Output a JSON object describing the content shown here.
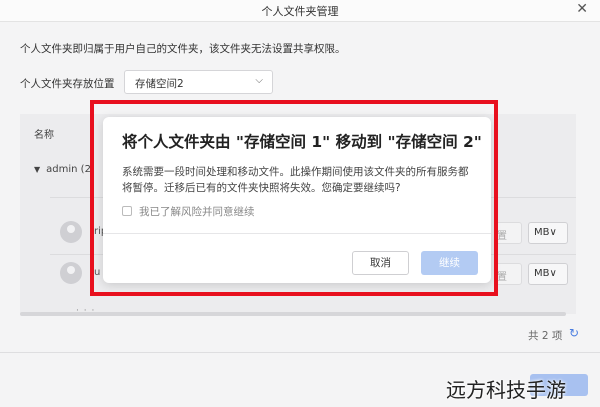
{
  "window": {
    "title": "个人文件夹管理"
  },
  "settings": {
    "description": "个人文件夹即归属于用户自己的文件夹，该文件夹无法设置共享权限。",
    "location_label": "个人文件夹存放位置",
    "location_value": "存储空间2"
  },
  "table": {
    "header_name": "名称",
    "group_label": "admin (2",
    "rows": [
      {
        "name_fragment": "rip",
        "unit_button": "MB∨"
      },
      {
        "name_fragment": "u",
        "unit_button": "MB∨"
      }
    ],
    "partial_button": "置"
  },
  "footer": {
    "count": "共 2 项"
  },
  "modal": {
    "title": "将个人文件夹由 \"存储空间 1\" 移动到 \"存储空间 2\"",
    "body": "系统需要一段时间处理和移动文件。此操作期间使用该文件夹的所有服务都将暂停。迁移后已有的文件夹快照将失效。您确定要继续吗?",
    "checkbox_label": "我已了解风险并同意继续",
    "cancel_label": "取消",
    "continue_label": "继续"
  },
  "watermark": "远方科技手游",
  "colors": {
    "highlight": "#e8101e",
    "primary_disabled": "#b3cbf3",
    "accent": "#4a7de0"
  },
  "icons": [
    "close-icon",
    "chevron-down-icon",
    "user-avatar-icon",
    "refresh-icon",
    "checkbox-icon"
  ]
}
